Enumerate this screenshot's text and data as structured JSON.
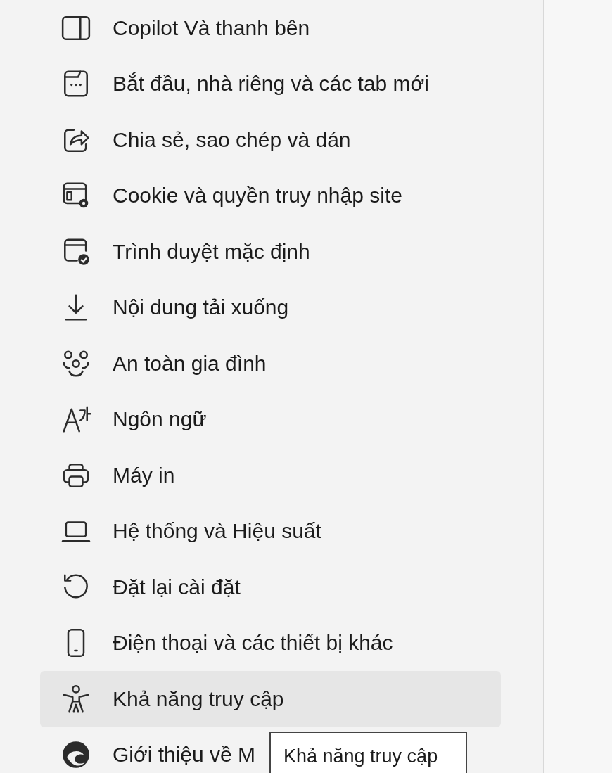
{
  "menu": {
    "items": [
      {
        "label": "Copilot Và thanh bên",
        "selected": false
      },
      {
        "label": "Bắt đầu, nhà riêng và các tab mới",
        "selected": false
      },
      {
        "label": "Chia sẻ, sao chép và dán",
        "selected": false
      },
      {
        "label": "Cookie và quyền truy nhập site",
        "selected": false
      },
      {
        "label": "Trình duyệt mặc định",
        "selected": false
      },
      {
        "label": "Nội dung tải xuống",
        "selected": false
      },
      {
        "label": "An toàn gia đình",
        "selected": false
      },
      {
        "label": "Ngôn ngữ",
        "selected": false
      },
      {
        "label": "Máy in",
        "selected": false
      },
      {
        "label": "Hệ thống và Hiệu suất",
        "selected": false
      },
      {
        "label": "Đặt lại cài đặt",
        "selected": false
      },
      {
        "label": "Điện thoại và các thiết bị khác",
        "selected": false
      },
      {
        "label": "Khả năng truy cập",
        "selected": true
      },
      {
        "label": "Giới thiệu về M",
        "selected": false
      }
    ]
  },
  "tooltip": "Khả năng truy cập"
}
